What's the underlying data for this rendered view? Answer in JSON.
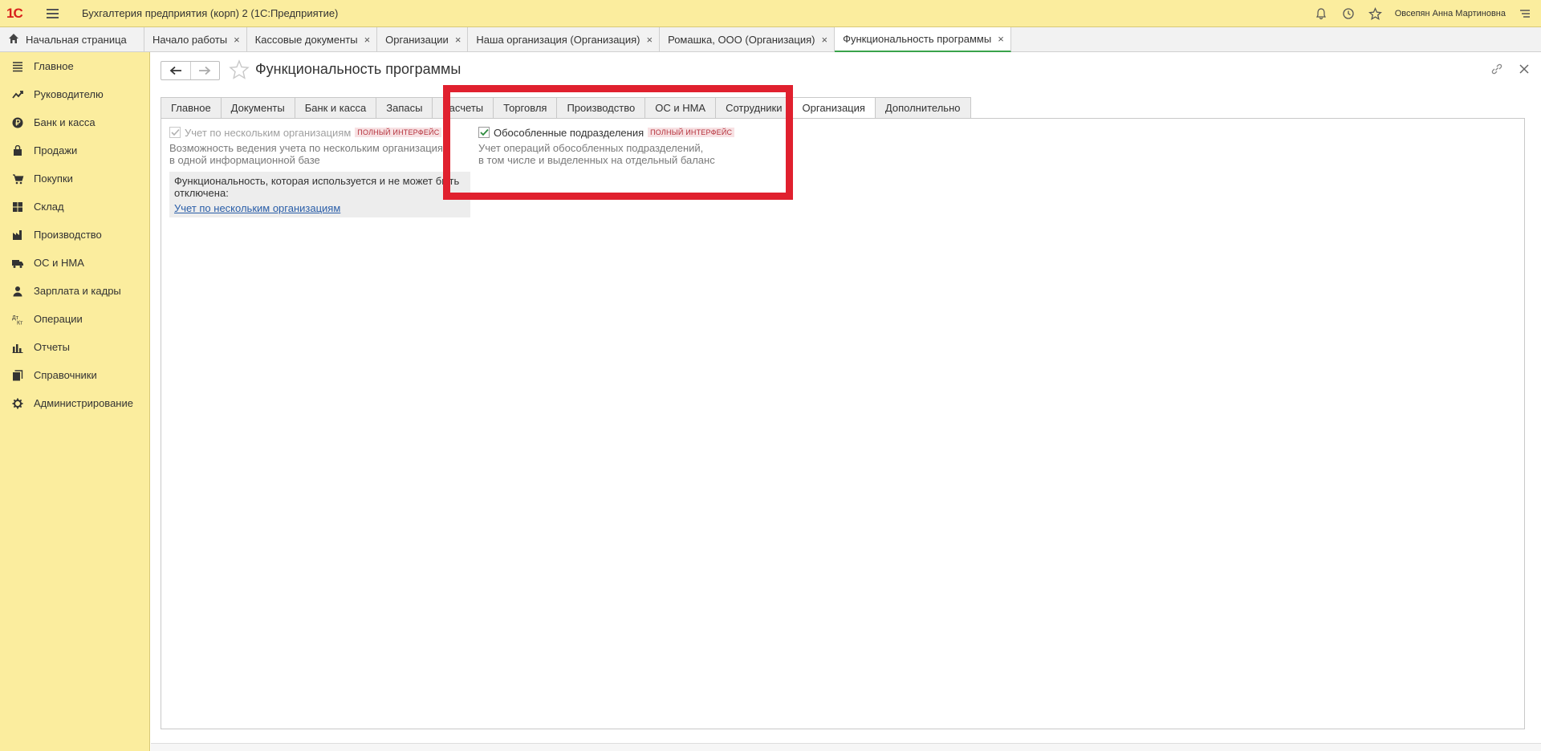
{
  "app": {
    "title": "Бухгалтерия предприятия (корп) 2   (1С:Предприятие)",
    "user": "Овсепян Анна Мартиновна",
    "logo_text": "1С"
  },
  "tabs": {
    "home_label": "Начальная страница",
    "items": [
      {
        "label": "Начало работы"
      },
      {
        "label": "Кассовые документы"
      },
      {
        "label": "Организации"
      },
      {
        "label": "Наша организация (Организация)"
      },
      {
        "label": "Ромашка, ООО (Организация)"
      },
      {
        "label": "Функциональность программы"
      }
    ],
    "close_glyph": "×"
  },
  "sidebar": {
    "items": [
      {
        "label": "Главное",
        "icon": "menu-icon"
      },
      {
        "label": "Руководителю",
        "icon": "trend-icon"
      },
      {
        "label": "Банк и касса",
        "icon": "ruble-icon"
      },
      {
        "label": "Продажи",
        "icon": "bag-icon"
      },
      {
        "label": "Покупки",
        "icon": "cart-icon"
      },
      {
        "label": "Склад",
        "icon": "warehouse-icon"
      },
      {
        "label": "Производство",
        "icon": "factory-icon"
      },
      {
        "label": "ОС и НМА",
        "icon": "truck-icon"
      },
      {
        "label": "Зарплата и кадры",
        "icon": "person-icon"
      },
      {
        "label": "Операции",
        "icon": "dt-kt-icon"
      },
      {
        "label": "Отчеты",
        "icon": "bar-chart-icon"
      },
      {
        "label": "Справочники",
        "icon": "books-icon"
      },
      {
        "label": "Администрирование",
        "icon": "gear-icon"
      }
    ]
  },
  "page": {
    "title": "Функциональность программы",
    "back_glyph": "🡐",
    "forward_glyph": "🡒",
    "form_tabs": [
      {
        "label": "Главное"
      },
      {
        "label": "Документы"
      },
      {
        "label": "Банк и касса"
      },
      {
        "label": "Запасы"
      },
      {
        "label": "Расчеты"
      },
      {
        "label": "Торговля"
      },
      {
        "label": "Производство"
      },
      {
        "label": "ОС и НМА"
      },
      {
        "label": "Сотрудники"
      },
      {
        "label": "Организация"
      },
      {
        "label": "Дополнительно"
      }
    ],
    "active_tab": "Организация"
  },
  "settings": {
    "multi_org": {
      "label": "Учет по нескольким организациям",
      "badge": "ПОЛНЫЙ ИНТЕРФЕЙС",
      "checked": true,
      "disabled": true,
      "desc_line1": "Возможность ведения учета по нескольким организациям",
      "desc_line2": "в одной информационной базе"
    },
    "info_box": {
      "text_line1": "Функциональность, которая используется и не может быть",
      "text_line2": "отключена:",
      "link": "Учет по нескольким организациям"
    },
    "separate_divisions": {
      "label": "Обособленные подразделения",
      "badge": "ПОЛНЫЙ ИНТЕРФЕЙС",
      "checked": true,
      "desc_line1": "Учет операций обособленных подразделений,",
      "desc_line2": "в том числе и выделенных на отдельный баланс"
    }
  },
  "colors": {
    "sidebar_bg": "#fbed9e",
    "highlight": "#e0202e",
    "active_tab_underline": "#3aa34a",
    "link": "#2a5ea8"
  }
}
